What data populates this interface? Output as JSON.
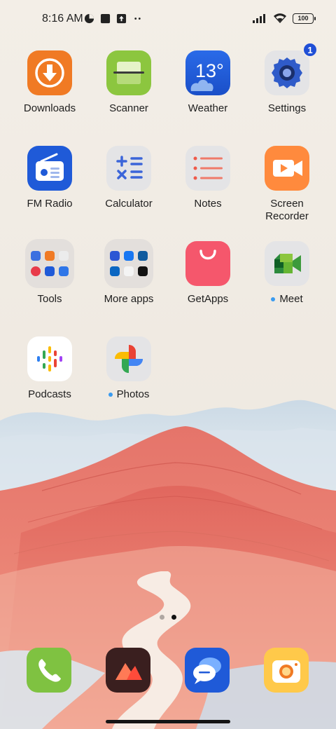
{
  "status_bar": {
    "time": "8:16 AM",
    "battery": "100"
  },
  "apps": [
    {
      "label": "Downloads"
    },
    {
      "label": "Scanner"
    },
    {
      "label": "Weather",
      "temperature": "13°"
    },
    {
      "label": "Settings",
      "badge": "1"
    },
    {
      "label": "FM Radio"
    },
    {
      "label": "Calculator"
    },
    {
      "label": "Notes"
    },
    {
      "label": "Screen Recorder",
      "label_line1": "Screen",
      "label_line2": "Recorder"
    },
    {
      "label": "Tools"
    },
    {
      "label": "More apps"
    },
    {
      "label": "GetApps"
    },
    {
      "label": "Meet"
    },
    {
      "label": "Podcasts"
    },
    {
      "label": "Photos"
    }
  ],
  "dock": [
    "phone-icon",
    "gallery-icon",
    "messaging-icon",
    "camera-icon"
  ],
  "page_indicator": {
    "pages": 2,
    "active": 2
  },
  "colors": {
    "downloads": "#f07a24",
    "scanner": "#8cc63f",
    "weather": "#1f5ad8",
    "settings": "#e4e4e6",
    "fm_radio": "#1f5ad8",
    "getapps": "#f5576c",
    "screen_recorder": "#ff8a3d",
    "badge": "#1f4fd6"
  }
}
